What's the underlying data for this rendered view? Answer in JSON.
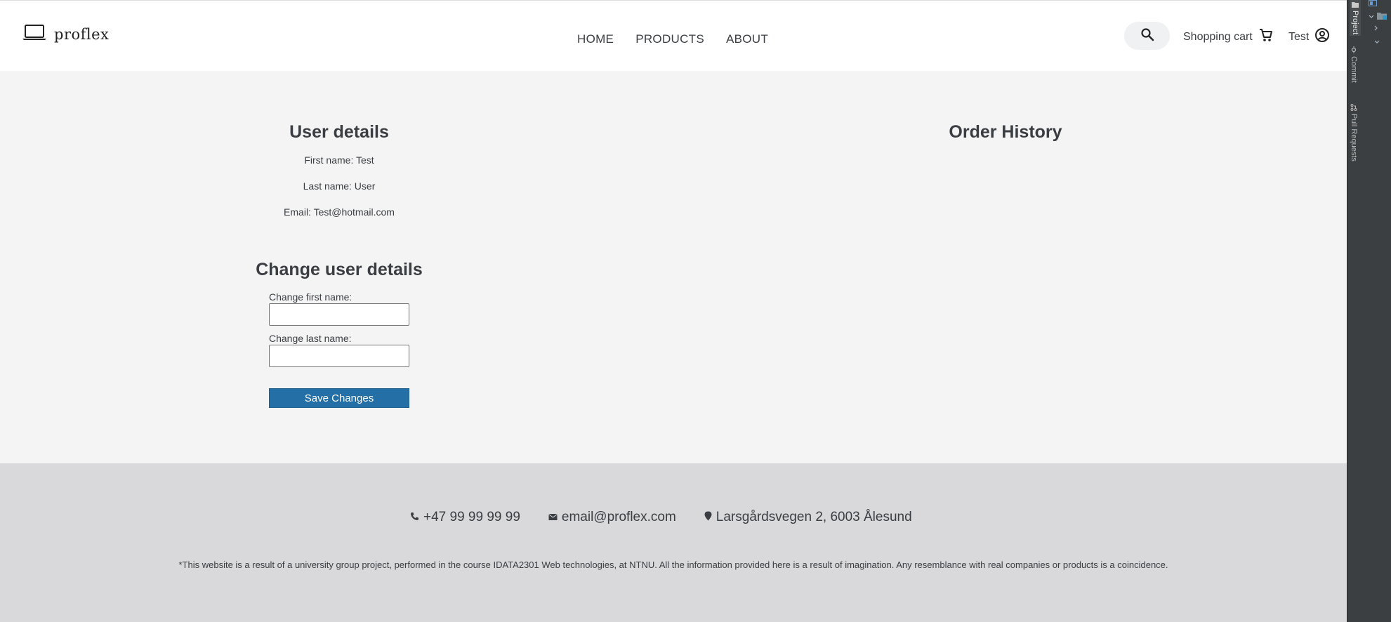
{
  "brand": {
    "logo_text": "proflex"
  },
  "nav": {
    "items": [
      {
        "label": "HOME"
      },
      {
        "label": "PRODUCTS"
      },
      {
        "label": "ABOUT"
      }
    ]
  },
  "header": {
    "cart_label": "Shopping cart",
    "user_name": "Test"
  },
  "user_details": {
    "title": "User details",
    "first_name": "First name: Test",
    "last_name": "Last name: User",
    "email": "Email: Test@hotmail.com"
  },
  "change_details": {
    "title": "Change user details",
    "first_name_label": "Change first name:",
    "first_name_value": "",
    "last_name_label": "Change last name:",
    "last_name_value": "",
    "save_label": "Save Changes"
  },
  "order_history": {
    "title": "Order History"
  },
  "footer": {
    "phone": "+47 99 99 99 99",
    "email": "email@proflex.com",
    "address": "Larsgårdsvegen 2, 6003 Ålesund",
    "disclaimer": "*This website is a result of a university group project, performed in the course IDATA2301 Web technologies, at NTNU. All the information provided here is a result of imagination. Any resemblance with real companies or products is a coincidence."
  },
  "ide": {
    "tabs": [
      {
        "label": "Project",
        "active": true
      },
      {
        "label": "Commit",
        "active": false
      },
      {
        "label": "Pull Requests",
        "active": false
      }
    ]
  },
  "colors": {
    "accent_button": "#2470a6",
    "main_bg": "#f4f4f4",
    "footer_bg": "#d9d9db",
    "text": "#3a3d42"
  }
}
